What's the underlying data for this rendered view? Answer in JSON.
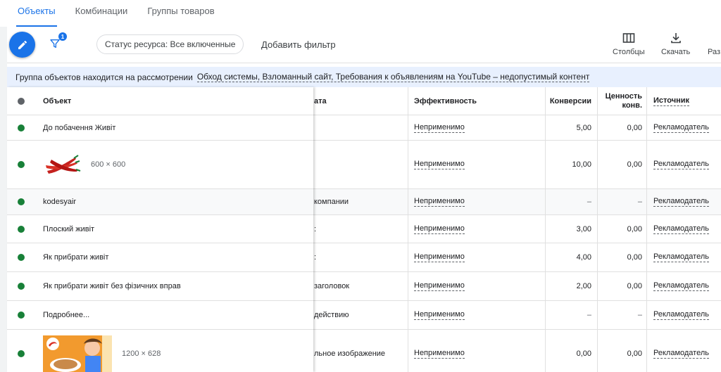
{
  "tabs": [
    "Объекты",
    "Комбинации",
    "Группы товаров"
  ],
  "toolbar": {
    "filter_count": "1",
    "status_chip": "Статус ресурса: Все включенные",
    "add_filter": "Добавить фильтр",
    "columns_label": "Столбцы",
    "download_label": "Скачать",
    "segment_label": "Раз"
  },
  "banner": {
    "text": "Группа объектов находится на рассмотрении",
    "reasons": "Обход системы, Взломанный сайт, Требования к объявлениям на YouTube – недопустимый контент"
  },
  "table": {
    "headers": {
      "object": "Объект",
      "type": "ата",
      "efficiency": "Эффективность",
      "conversions": "Конверсии",
      "value_line1": "Ценность",
      "value_line2": "конв.",
      "source": "Источник"
    },
    "rows": [
      {
        "object": "До побачення Живіт",
        "type": "",
        "efficiency": "Неприменимо",
        "conversions": "5,00",
        "value": "0,00",
        "source": "Рекламодатель"
      },
      {
        "object": "",
        "image_size": "600 × 600",
        "type": "",
        "efficiency": "Неприменимо",
        "conversions": "10,00",
        "value": "0,00",
        "source": "Рекламодатель"
      },
      {
        "object": "kodesyair",
        "type": "компании",
        "efficiency": "Неприменимо",
        "conversions": "–",
        "value": "–",
        "source": "Рекламодатель"
      },
      {
        "object": "Плоский живіт",
        "type": ":",
        "efficiency": "Неприменимо",
        "conversions": "3,00",
        "value": "0,00",
        "source": "Рекламодатель"
      },
      {
        "object": "Як прибрати живіт",
        "type": ":",
        "efficiency": "Неприменимо",
        "conversions": "4,00",
        "value": "0,00",
        "source": "Рекламодатель"
      },
      {
        "object": "Як прибрати живіт без фізичних вправ",
        "type": "заголовок",
        "efficiency": "Неприменимо",
        "conversions": "2,00",
        "value": "0,00",
        "source": "Рекламодатель"
      },
      {
        "object": "Подробнее...",
        "type": "действию",
        "efficiency": "Неприменимо",
        "conversions": "–",
        "value": "–",
        "source": "Рекламодатель"
      },
      {
        "object": "",
        "image_size": "1200 × 628",
        "type": "льное изображение",
        "efficiency": "Неприменимо",
        "conversions": "0,00",
        "value": "0,00",
        "source": "Рекламодатель"
      }
    ]
  },
  "colors": {
    "accent": "#1a73e8",
    "status_green": "#188038",
    "banner_bg": "#e8f0fe"
  }
}
